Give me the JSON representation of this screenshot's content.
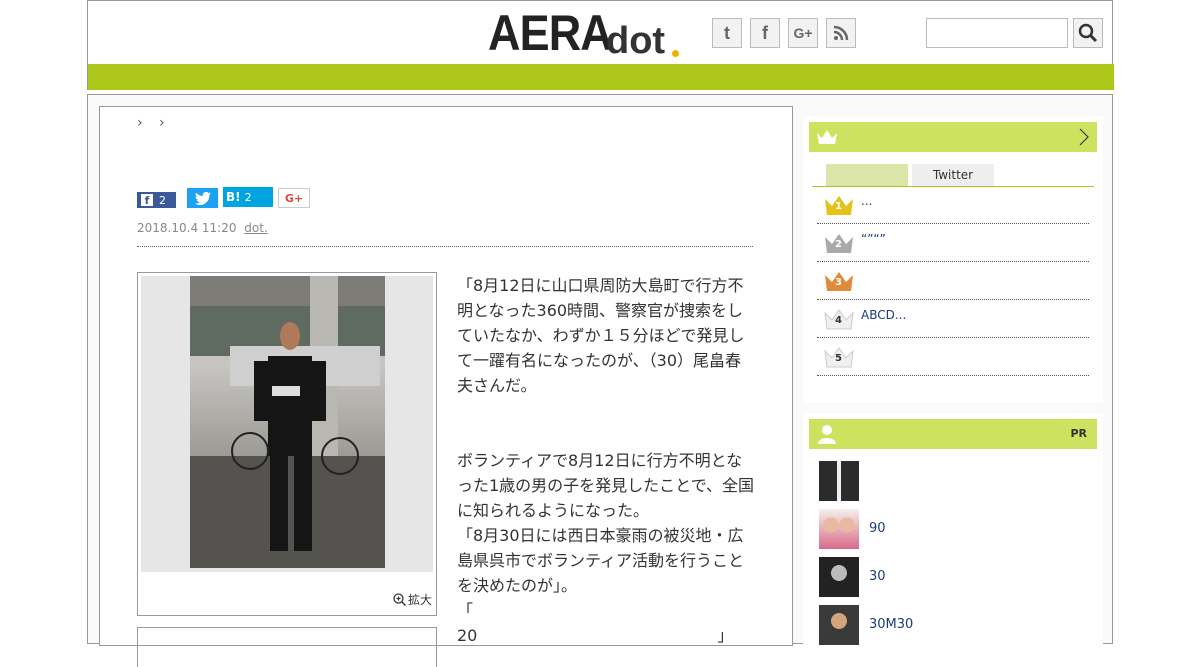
{
  "header": {
    "logo_main": "AERA",
    "logo_sub": "dot",
    "social": [
      {
        "icon": "twitter-icon",
        "glyph": "t"
      },
      {
        "icon": "facebook-icon",
        "glyph": "f"
      },
      {
        "icon": "google-plus-icon",
        "glyph": "G+"
      },
      {
        "icon": "rss-icon",
        "glyph": ")"
      }
    ],
    "search_placeholder": ""
  },
  "article": {
    "breadcrumb": "› ›",
    "share": {
      "facebook_count": "2",
      "hatena_label": "B!",
      "hatena_count": "2",
      "gplus_label": "G+"
    },
    "date": "2018.10.4 11:20",
    "source": "dot.",
    "enlarge_label": "拡大",
    "paragraphs": [
      {
        "text": "「8月12日に山口県周防大島町で行方不明となった360時間、警察官が捜索をしていたなか、わずか１５分ほどで発見して一躍有名になったのが、（30）尾畠春夫さんだ。",
        "link": false
      },
      {
        "text": "　　　　　　　　　　　　　　　　　　　　　　　　　　　　　　　",
        "link": true
      },
      {
        "text": "ボランティアで8月12日に行方不明となった1歳の男の子を発見したことで、全国に知られるようになった。",
        "link": false
      },
      {
        "text": "「8月30日には西日本豪雨の被災地・広島県呉市でボランティア活動を行うことを決めたのが」。",
        "link": false
      },
      {
        "text": "「　　　　　　　　　　　　　　　　　　　　　　　　　　　　　　　　　　　　　　20　　　　　　　　　　　　　　　」",
        "link": false
      }
    ]
  },
  "ranking": {
    "tabs": [
      "",
      "Twitter"
    ],
    "items": [
      {
        "rank": "1",
        "title": "...",
        "color": "#e3c21a"
      },
      {
        "rank": "2",
        "title": "“”“”",
        "color": "#a9a9a9"
      },
      {
        "rank": "3",
        "title": "",
        "color": "#e08a3c"
      },
      {
        "rank": "4",
        "title": "ABCD...",
        "color": "#ffffff"
      },
      {
        "rank": "5",
        "title": "",
        "color": "#ffffff"
      }
    ]
  },
  "pr": {
    "label": "PR",
    "items": [
      {
        "title": ""
      },
      {
        "title": "90"
      },
      {
        "title": "30"
      },
      {
        "title": "30M30"
      }
    ]
  },
  "colors": {
    "accent_green": "#adc71b",
    "sidebar_head": "#cde25f",
    "link": "#1a3c7a"
  }
}
